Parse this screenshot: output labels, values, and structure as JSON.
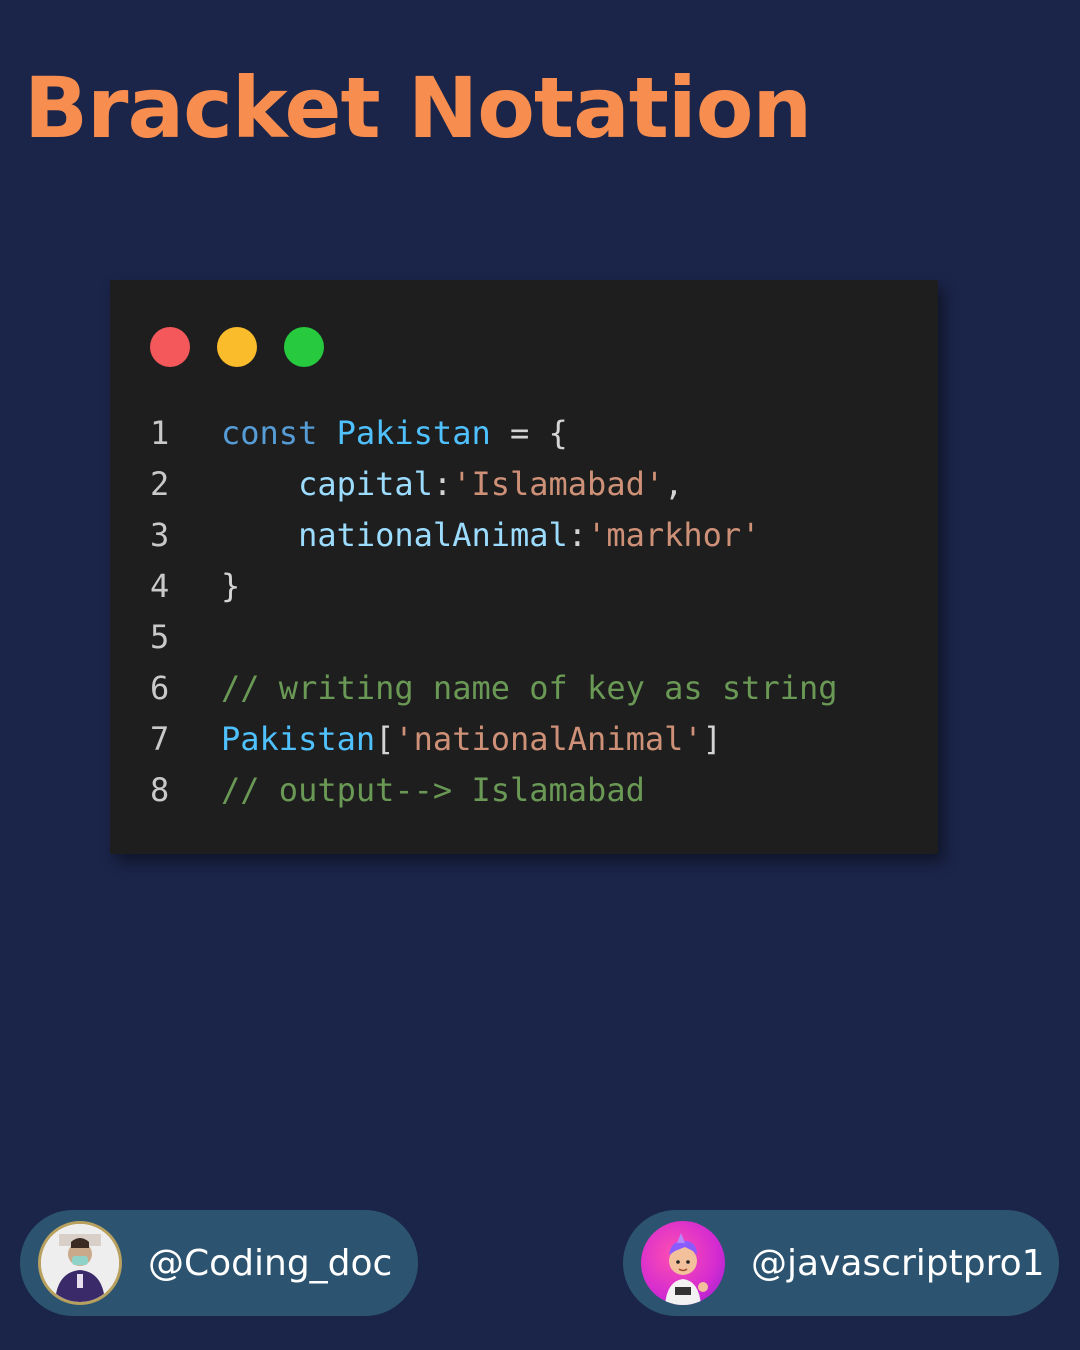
{
  "title": "Bracket Notation",
  "window_dots": [
    "red",
    "yellow",
    "green"
  ],
  "colors": {
    "background": "#1b254a",
    "title": "#f78e4f",
    "code_background": "#1e1e1e",
    "handle_background": "#2c5470"
  },
  "code_lines": [
    {
      "number": "1",
      "tokens": [
        {
          "text": "const ",
          "type": "kw"
        },
        {
          "text": "Pakistan",
          "type": "var"
        },
        {
          "text": " = {",
          "type": "punc"
        }
      ]
    },
    {
      "number": "2",
      "tokens": [
        {
          "text": "    capital",
          "type": "prop"
        },
        {
          "text": ":",
          "type": "punc"
        },
        {
          "text": "'Islamabad'",
          "type": "str"
        },
        {
          "text": ",",
          "type": "punc"
        }
      ]
    },
    {
      "number": "3",
      "tokens": [
        {
          "text": "    nationalAnimal",
          "type": "prop"
        },
        {
          "text": ":",
          "type": "punc"
        },
        {
          "text": "'markhor'",
          "type": "str"
        }
      ]
    },
    {
      "number": "4",
      "tokens": [
        {
          "text": "}",
          "type": "punc"
        }
      ]
    },
    {
      "number": "5",
      "tokens": []
    },
    {
      "number": "6",
      "tokens": [
        {
          "text": "// writing name of key as string",
          "type": "cmt"
        }
      ]
    },
    {
      "number": "7",
      "tokens": [
        {
          "text": "Pakistan",
          "type": "var"
        },
        {
          "text": "[",
          "type": "punc"
        },
        {
          "text": "'nationalAnimal'",
          "type": "str"
        },
        {
          "text": "]",
          "type": "punc"
        }
      ]
    },
    {
      "number": "8",
      "tokens": [
        {
          "text": "// output--> Islamabad",
          "type": "cmt"
        }
      ]
    }
  ],
  "handles": {
    "left": {
      "text": "@Coding_doc"
    },
    "right": {
      "text": "@javascriptpro1"
    }
  }
}
